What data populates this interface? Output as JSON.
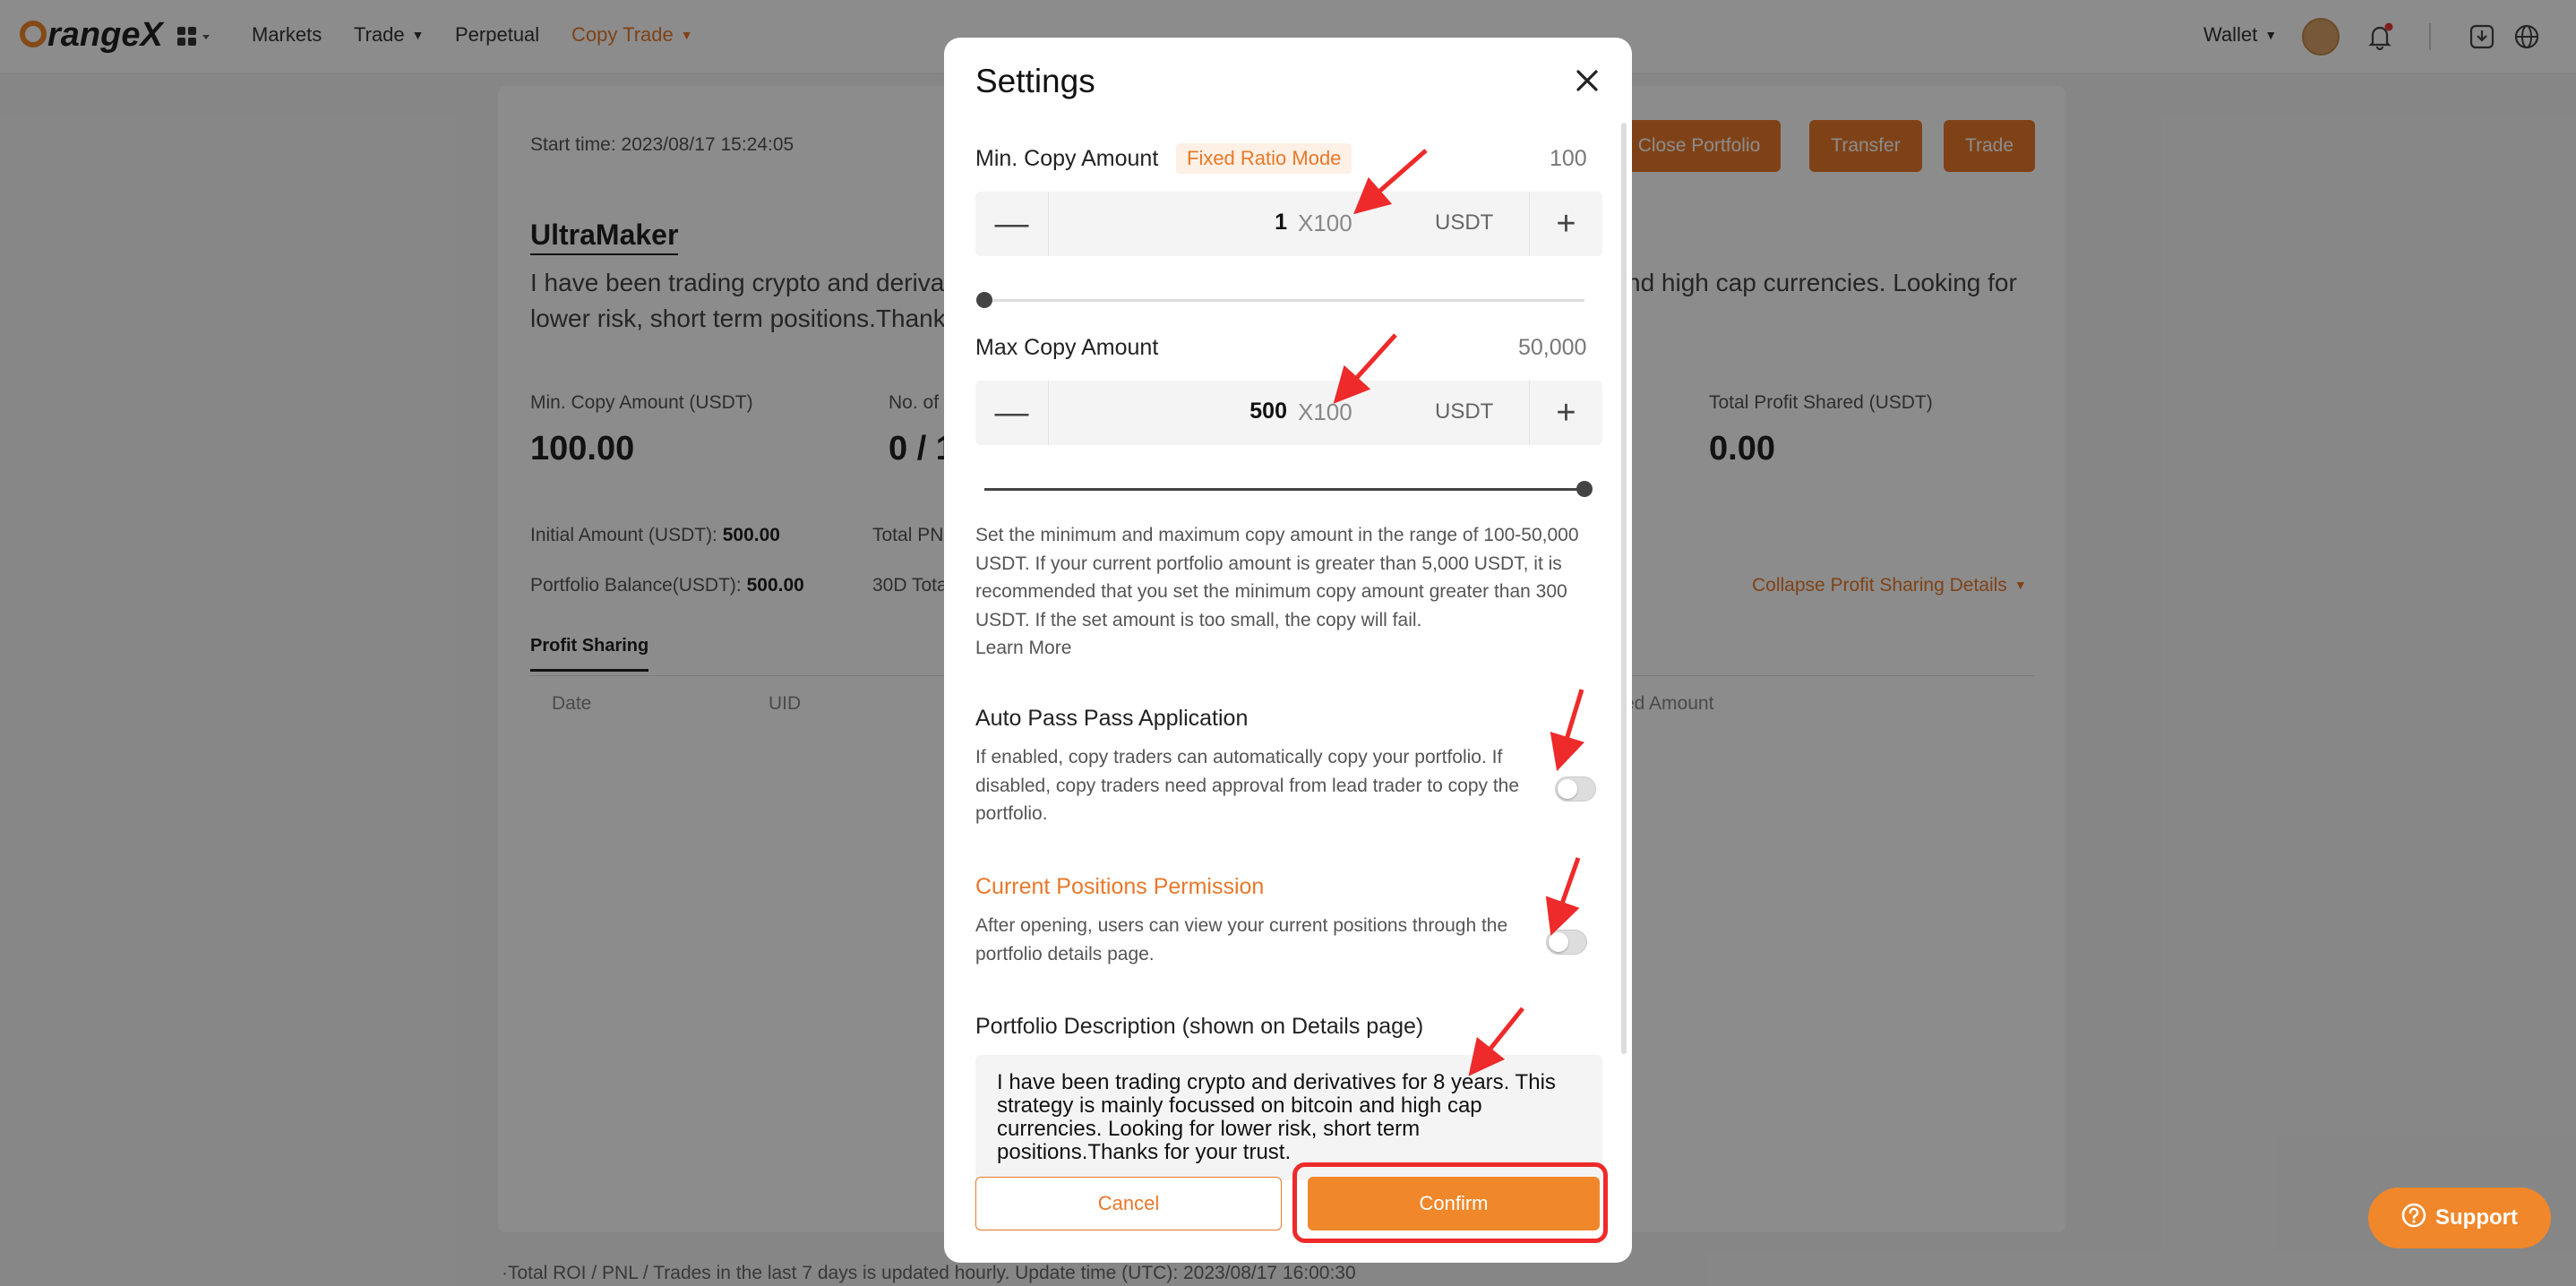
{
  "nav": {
    "logo_text": "rangeX",
    "markets": "Markets",
    "trade": "Trade",
    "perpetual": "Perpetual",
    "copy_trade": "Copy Trade",
    "wallet": "Wallet",
    "accent_color": "#e8782a"
  },
  "page": {
    "start_time": "Start time: 2023/08/17 15:24:05",
    "close_portfolio": "Close Portfolio",
    "transfer": "Transfer",
    "trade": "Trade",
    "name": "UltraMaker",
    "desc_left_1": "I have been trading crypto and deriva",
    "desc_right_1": "nd high cap currencies. Looking for",
    "desc_left_2": "lower risk, short term positions.Thank",
    "min_copy_label": "Min. Copy Amount (USDT)",
    "min_copy_value": "100.00",
    "no_of_label": "No. of",
    "no_of_value": "0 / 1",
    "total_profit_label": "Total Profit Shared (USDT)",
    "total_profit_value": "0.00",
    "initial_amount_label": "Initial Amount (USDT):",
    "initial_amount_value": "500.00",
    "total_pn_label": "Total PN",
    "portfolio_balance_label": "Portfolio Balance(USDT):",
    "portfolio_balance_value": "500.00",
    "d30_label": "30D Tota",
    "collapse_link": "Collapse Profit Sharing Details",
    "tab_profit_sharing": "Profit Sharing",
    "col_date": "Date",
    "col_uid": "UID",
    "col_shared_amount": "red Amount",
    "footer_note": "·Total ROI / PNL / Trades in the last 7 days is updated hourly. Update time (UTC): 2023/08/17 16:00:30"
  },
  "modal": {
    "title": "Settings",
    "min_label": "Min. Copy Amount",
    "fixed_ratio_tag": "Fixed Ratio Mode",
    "min_hint": "100",
    "min_value": "1",
    "min_multiplier": "X100",
    "min_unit": "USDT",
    "min_slider_fraction": 0.0,
    "max_label": "Max Copy Amount",
    "max_hint": "50,000",
    "max_value": "500",
    "max_multiplier": "X100",
    "max_unit": "USDT",
    "max_slider_fraction": 1.0,
    "range_note": "Set the minimum and maximum copy amount in the range of 100-50,000 USDT. If your current portfolio amount is greater than 5,000 USDT, it is recommended that you set the minimum copy amount greater than 300 USDT. If the set amount is too small, the copy will fail.",
    "learn_more": "Learn More",
    "auto_pass_title": "Auto Pass Pass Application",
    "auto_pass_desc": "If enabled, copy traders can automatically copy your portfolio. If disabled, copy traders need approval from lead trader to copy the portfolio.",
    "auto_pass_enabled": false,
    "positions_title": "Current Positions Permission",
    "positions_desc": "After opening, users can view your current positions through the portfolio details page.",
    "positions_enabled": false,
    "description_label": "Portfolio Description (shown on Details page)",
    "description_value": "I have been trading crypto and derivatives for 8 years. This strategy is mainly focussed on bitcoin and high cap currencies. Looking for lower risk, short term positions.Thanks for your trust.",
    "cancel": "Cancel",
    "confirm": "Confirm"
  },
  "support": {
    "label": "Support"
  }
}
